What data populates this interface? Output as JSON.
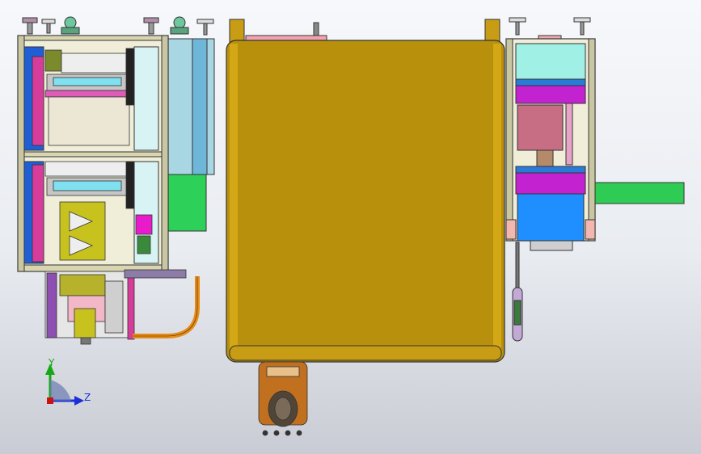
{
  "viewport": {
    "background_top": "#f7f8fb",
    "background_bottom": "#c9ccd4"
  },
  "triad": {
    "y_label": "Y",
    "z_label": "Z",
    "y_color": "#16a816",
    "z_color": "#1c2fd6",
    "origin_color": "#cc1111"
  },
  "views": {
    "left": {
      "name": "front-view"
    },
    "center": {
      "name": "side-view",
      "panel_color": "#b8900c"
    },
    "right": {
      "name": "end-view"
    }
  }
}
